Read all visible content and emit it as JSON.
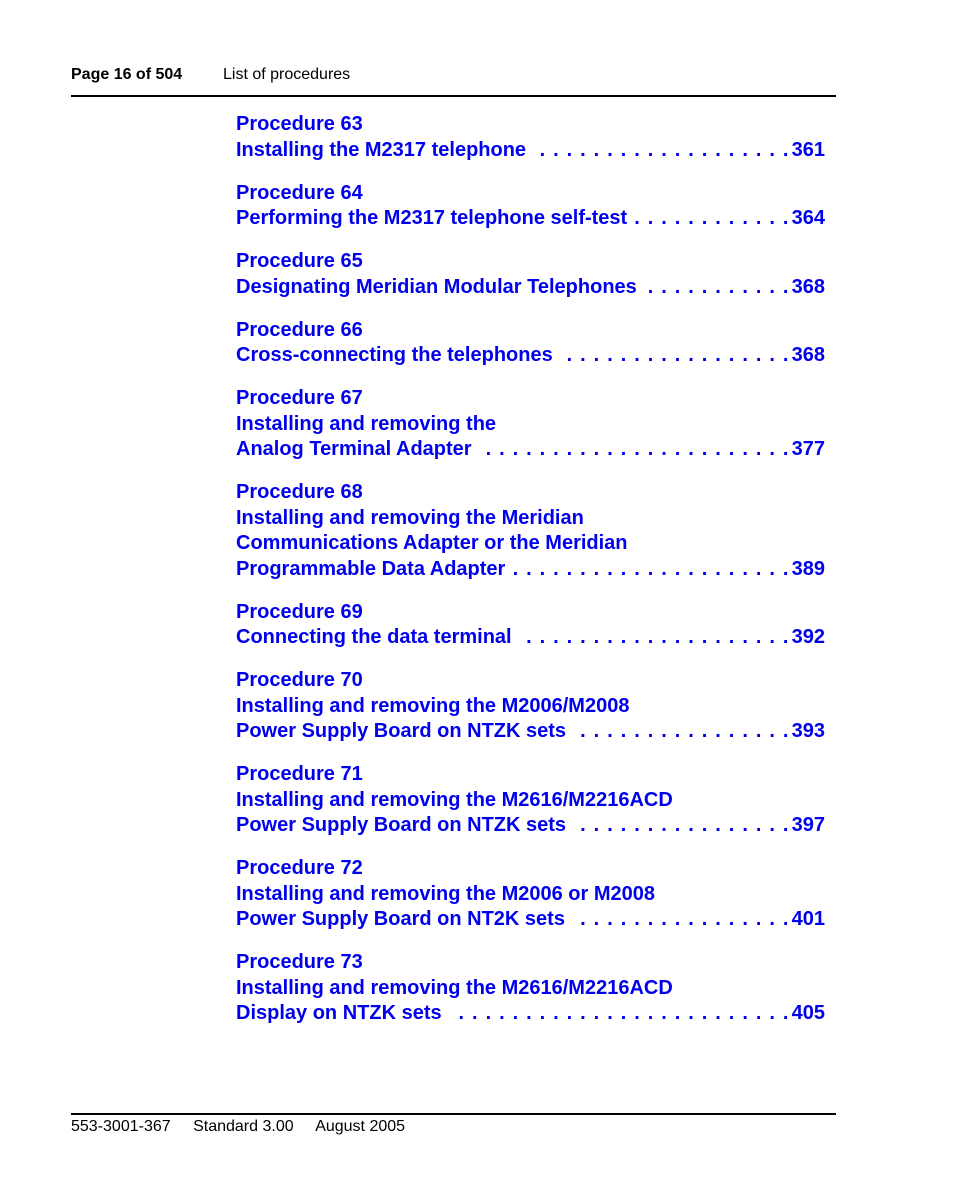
{
  "header": {
    "page_label": "Page 16 of 504",
    "section_title": "List of procedures"
  },
  "footer": {
    "doc_number": "553-3001-367",
    "standard": "Standard 3.00",
    "date": "August 2005"
  },
  "link_color": "#0000ee",
  "entries": [
    {
      "title": "Procedure 63",
      "lines": [],
      "last": "Installing the M2317 telephone",
      "page": "361"
    },
    {
      "title": "Procedure 64",
      "lines": [],
      "last": "Performing the M2317 telephone self-test",
      "page": "364"
    },
    {
      "title": "Procedure 65",
      "lines": [],
      "last": "Designating Meridian Modular Telephones",
      "page": "368"
    },
    {
      "title": "Procedure 66",
      "lines": [],
      "last": "Cross-connecting the telephones",
      "page": "368"
    },
    {
      "title": "Procedure 67",
      "lines": [
        "Installing and removing the"
      ],
      "last": "Analog Terminal Adapter",
      "page": "377"
    },
    {
      "title": "Procedure 68",
      "lines": [
        "Installing and removing the Meridian",
        "Communications Adapter or the Meridian"
      ],
      "last": "Programmable Data Adapter",
      "page": "389"
    },
    {
      "title": "Procedure 69",
      "lines": [],
      "last": "Connecting the data terminal",
      "page": "392"
    },
    {
      "title": "Procedure 70",
      "lines": [
        "Installing and removing the M2006/M2008"
      ],
      "last": "Power Supply Board on NTZK sets",
      "page": "393"
    },
    {
      "title": "Procedure 71",
      "lines": [
        "Installing and removing the M2616/M2216ACD"
      ],
      "last": "Power Supply Board on NTZK sets",
      "page": "397"
    },
    {
      "title": "Procedure 72",
      "lines": [
        "Installing and removing the M2006 or M2008"
      ],
      "last": "Power Supply Board on NT2K sets",
      "page": "401"
    },
    {
      "title": "Procedure 73",
      "lines": [
        "Installing and removing the M2616/M2216ACD"
      ],
      "last": "Display on NTZK sets",
      "page": "405"
    }
  ]
}
